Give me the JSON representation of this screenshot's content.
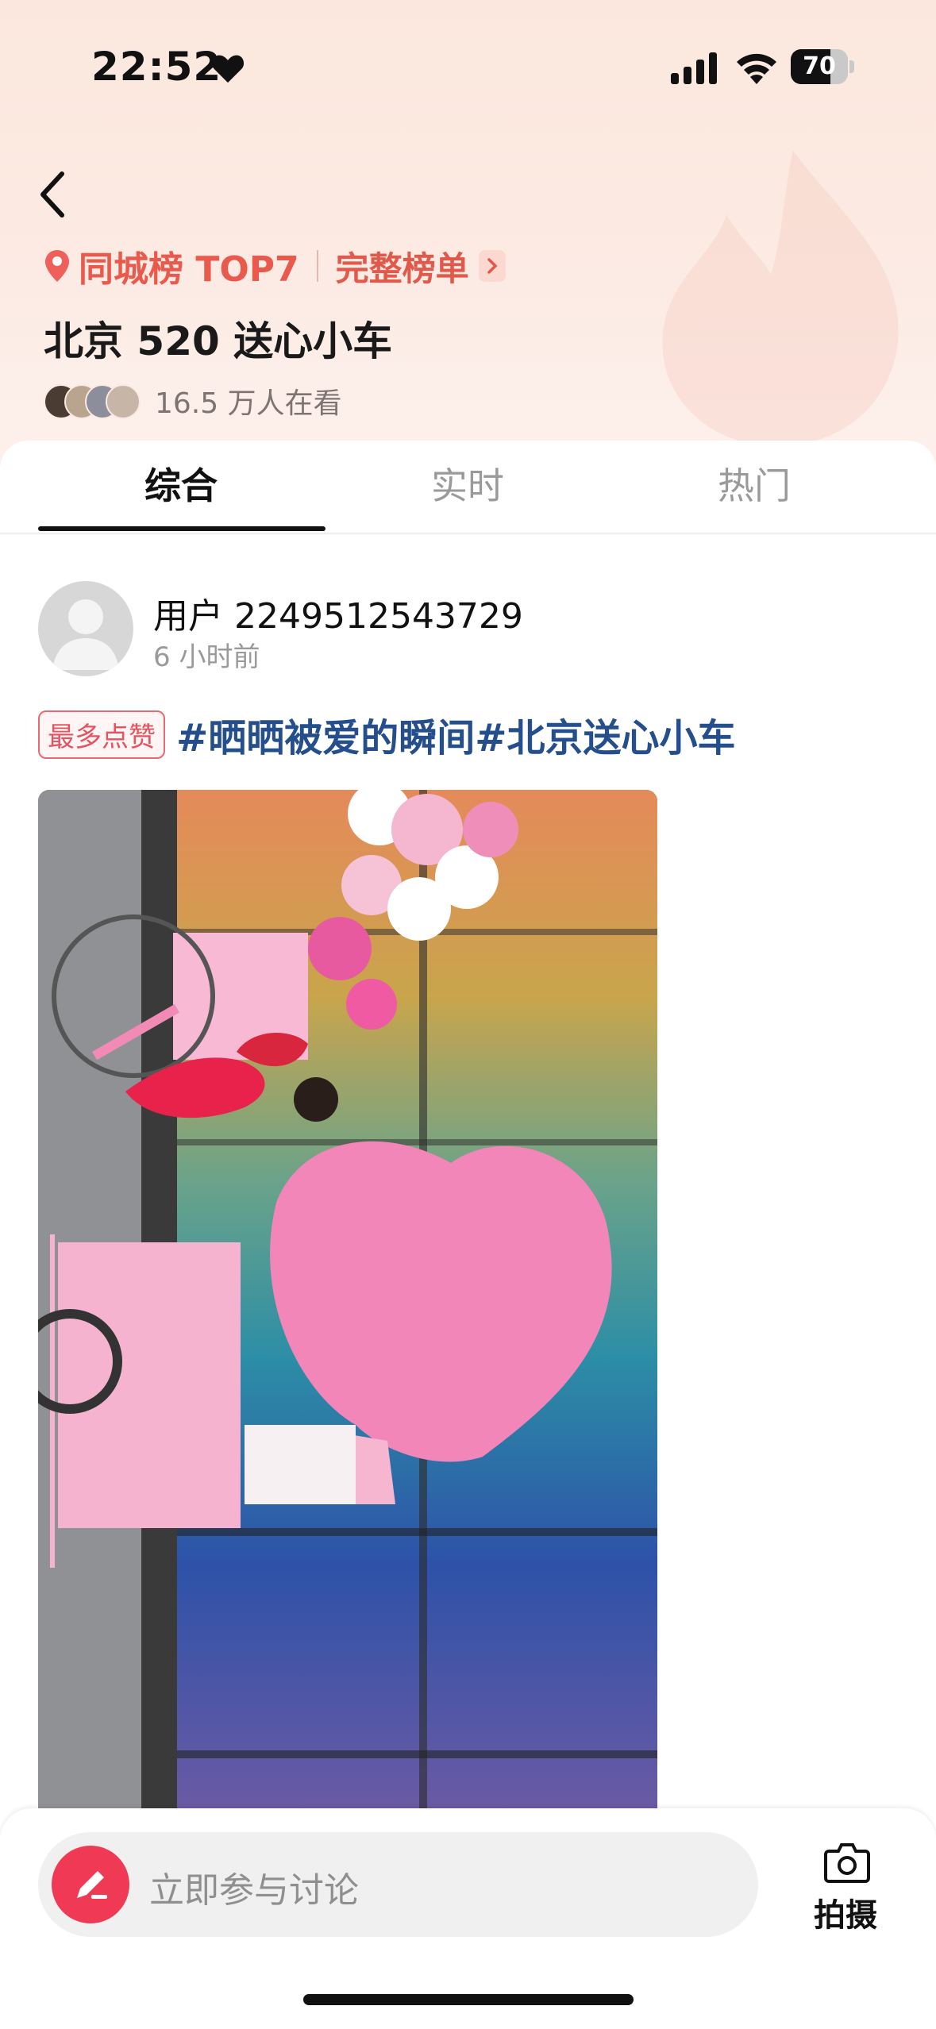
{
  "status_bar": {
    "time": "22:52",
    "battery": "70",
    "battery_level": 0.7
  },
  "header": {
    "rank_text": "同城榜 TOP7",
    "rank_link": "完整榜单",
    "title": "北京 520 送心小车",
    "viewers": "16.5 万人在看"
  },
  "tabs": [
    {
      "label": "综合",
      "active": true
    },
    {
      "label": "实时",
      "active": false
    },
    {
      "label": "热门",
      "active": false
    }
  ],
  "post": {
    "username": "用户 2249512543729",
    "time": "6 小时前",
    "badge": "最多点赞",
    "hashtags": "#晒晒被爱的瞬间#北京送心小车"
  },
  "bottom_bar": {
    "comment_placeholder": "立即参与讨论",
    "camera_label": "拍摄"
  },
  "colors": {
    "accent": "#ea5a4c",
    "hashtag": "#244e8c",
    "pencil_bg": "#f03a55"
  },
  "icons": [
    "heart-icon",
    "signal-icon",
    "wifi-icon",
    "back-icon",
    "location-pin-icon",
    "chevron-right-icon",
    "pencil-icon",
    "camera-icon"
  ]
}
